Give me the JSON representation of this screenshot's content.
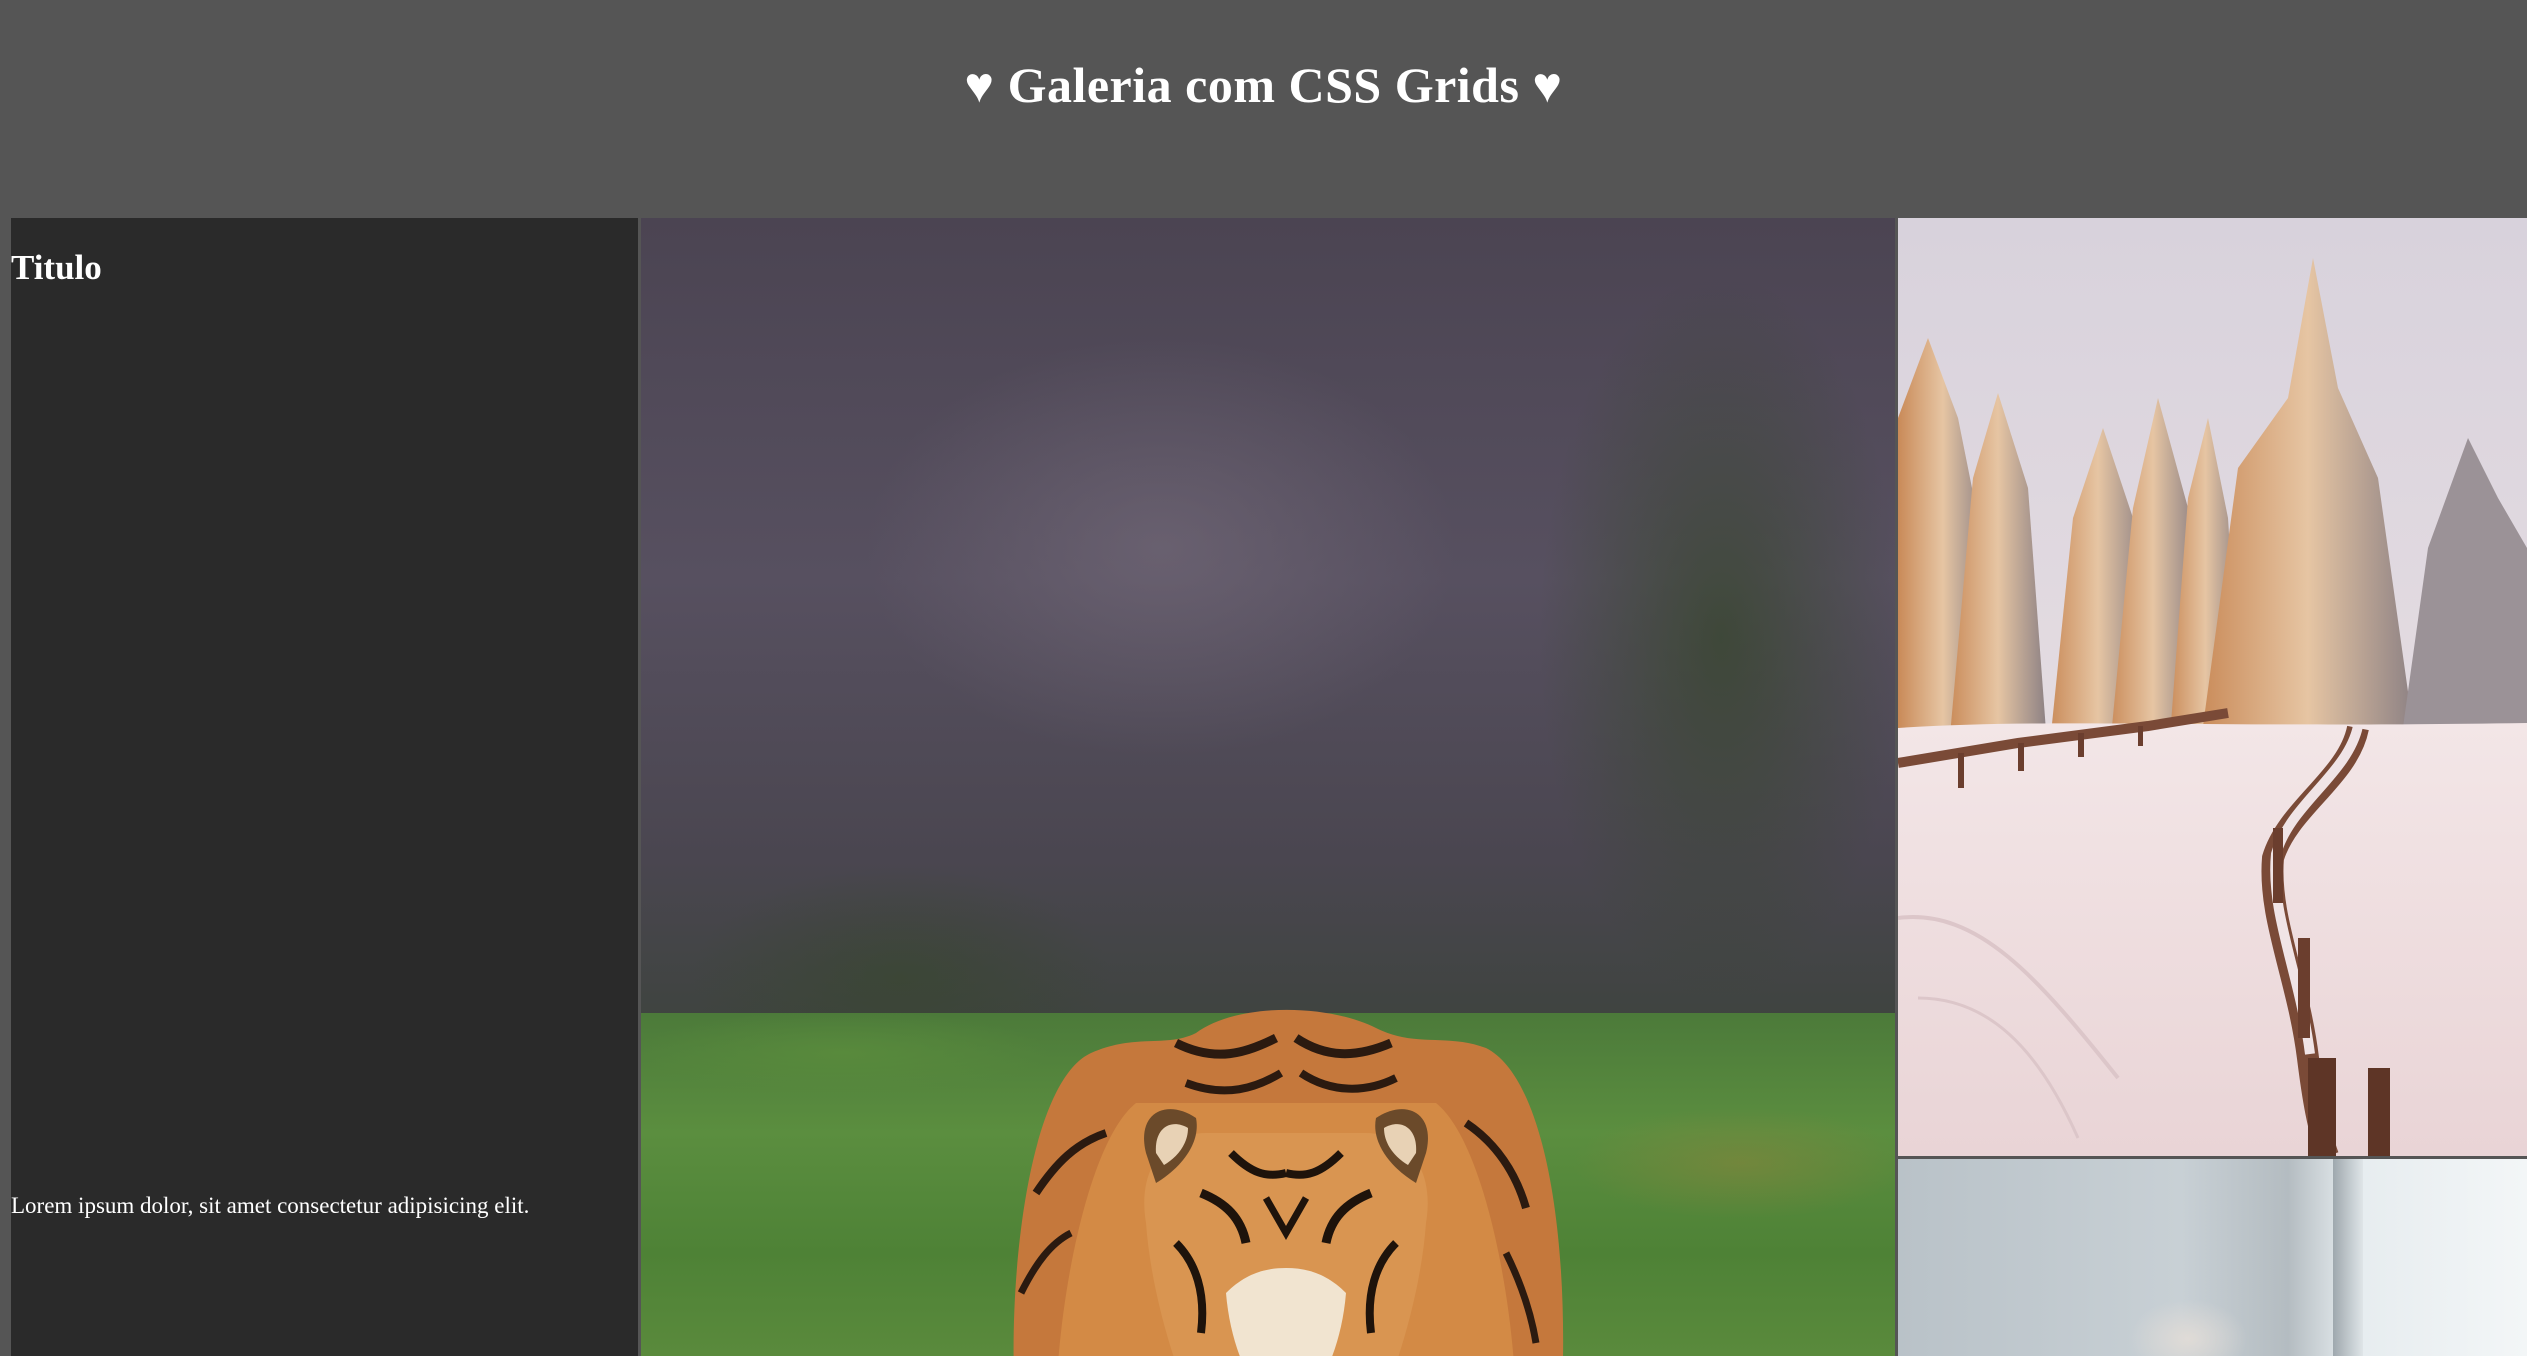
{
  "header": {
    "title": "♥ Galeria com CSS Grids ♥"
  },
  "gallery": {
    "text_card": {
      "title": "Titulo",
      "body": "Lorem ipsum dolor, sit amet consectetur adipisicing elit."
    },
    "photos": [
      {
        "subject": "tiger"
      },
      {
        "subject": "snowy-forest-path"
      },
      {
        "subject": "window-interior"
      }
    ]
  },
  "colors": {
    "page_background": "#555555",
    "card_background": "#2a2a2a",
    "text": "#ffffff"
  }
}
